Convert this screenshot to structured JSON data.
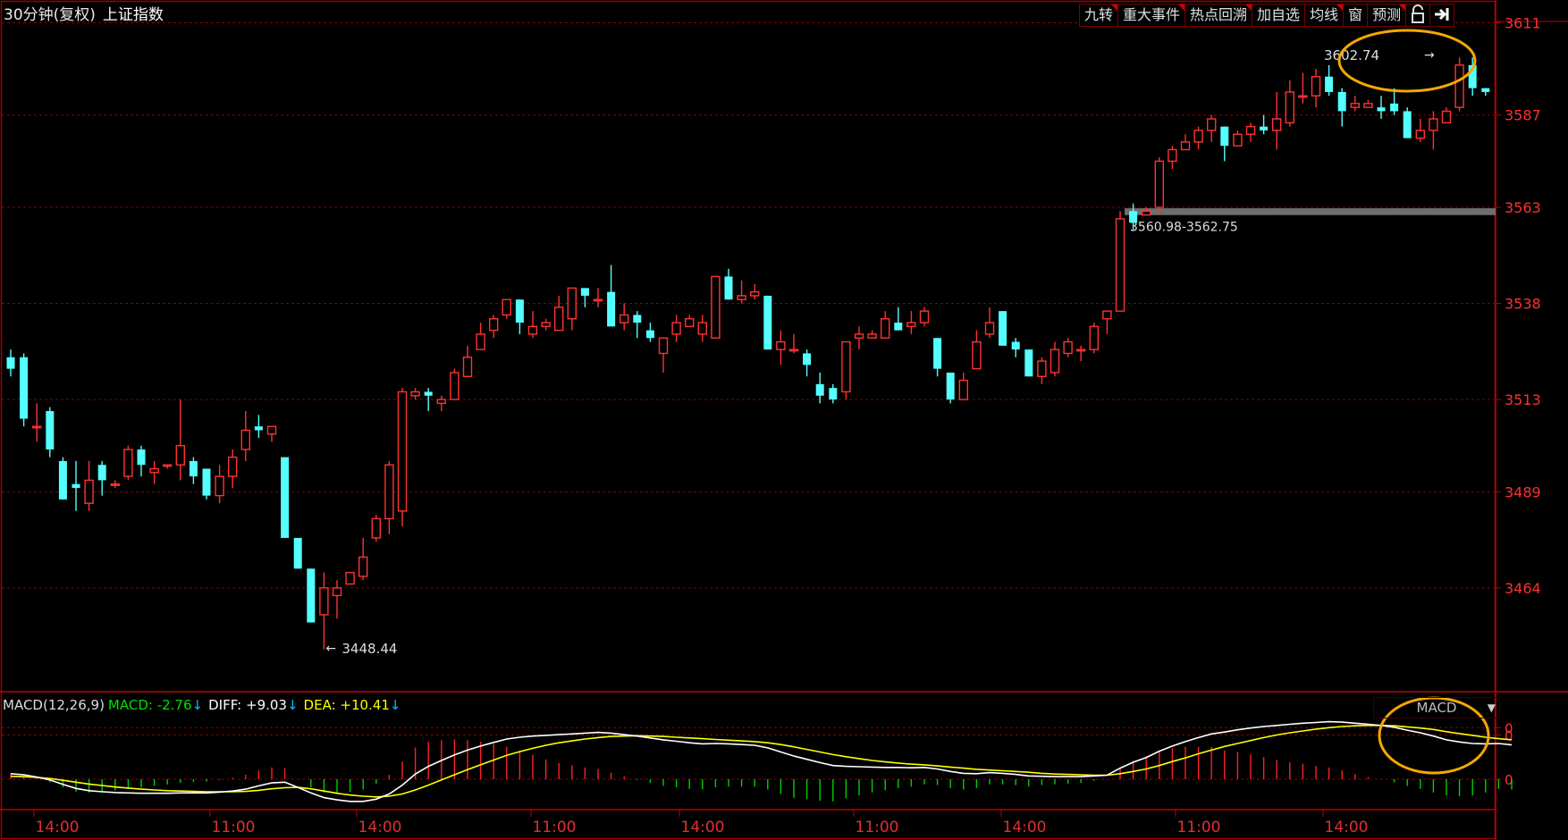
{
  "header": {
    "period": "30分钟(复权)",
    "index_name": "上证指数"
  },
  "toolbar": [
    "九转",
    "重大事件",
    "热点回溯",
    "加自选",
    "均线",
    "窗",
    "预测"
  ],
  "toolbar_icons": [
    "lock-icon",
    "exit-icon"
  ],
  "price_axis": {
    "ticks": [
      "3611",
      "3587",
      "3563",
      "3538",
      "3513",
      "3489",
      "3464"
    ]
  },
  "time_axis": {
    "ticks": [
      "14:00",
      "11:00",
      "14:00",
      "11:00",
      "14:00",
      "11:00",
      "14:00",
      "11:00",
      "14:00"
    ]
  },
  "annotations": {
    "high": "3602.74",
    "low": "3448.44",
    "gap": "3560.98-3562.75"
  },
  "macd": {
    "title": "MACD(12,26,9)",
    "macd_label": "MACD: -2.76",
    "diff_label": "DIFF: +9.03",
    "dea_label": "DEA: +10.41",
    "selector": "MACD",
    "axis_ticks": [
      "0",
      "0",
      "0"
    ]
  },
  "colors": {
    "up": "#ff3232",
    "down": "#54ffff",
    "grid": "#8a0000",
    "axis": "#c00000",
    "diff": "#ffffff",
    "dea": "#ffff00",
    "highlight": "#f5a800"
  },
  "chart_data": {
    "type": "candlestick",
    "ylim": [
      3437,
      3616
    ],
    "candles": [
      [
        3524,
        3521,
        3526,
        3519
      ],
      [
        3524,
        3508,
        3525,
        3506
      ],
      [
        3506,
        3506,
        3512,
        3502
      ],
      [
        3510,
        3500,
        3511,
        3498
      ],
      [
        3497,
        3487,
        3498,
        3487
      ],
      [
        3491,
        3490,
        3497,
        3484
      ],
      [
        3486,
        3492,
        3497,
        3484
      ],
      [
        3496,
        3492,
        3497,
        3488
      ],
      [
        3491,
        3491,
        3492,
        3490
      ],
      [
        3493,
        3500,
        3501,
        3492
      ],
      [
        3500,
        3496,
        3501,
        3493
      ],
      [
        3494,
        3495,
        3497,
        3491
      ],
      [
        3496,
        3496,
        3496,
        3495
      ],
      [
        3496,
        3501,
        3513,
        3492
      ],
      [
        3497,
        3493,
        3498,
        3491
      ],
      [
        3495,
        3488,
        3495,
        3487
      ],
      [
        3488,
        3493,
        3496,
        3486
      ],
      [
        3493,
        3498,
        3500,
        3490
      ],
      [
        3500,
        3505,
        3510,
        3497
      ],
      [
        3506,
        3505,
        3509,
        3503
      ],
      [
        3504,
        3506,
        3506,
        3502
      ],
      [
        3498,
        3477,
        3498,
        3477
      ],
      [
        3477,
        3469,
        3477,
        3469
      ],
      [
        3469,
        3455,
        3469,
        3455
      ],
      [
        3457,
        3464,
        3468,
        3448
      ],
      [
        3462,
        3464,
        3466,
        3456
      ],
      [
        3465,
        3468,
        3468,
        3465
      ],
      [
        3467,
        3472,
        3477,
        3466
      ],
      [
        3477,
        3482,
        3483,
        3476
      ],
      [
        3482,
        3496,
        3497,
        3478
      ],
      [
        3484,
        3515,
        3516,
        3480
      ],
      [
        3514,
        3515,
        3516,
        3513
      ],
      [
        3515,
        3514,
        3516,
        3510
      ],
      [
        3512,
        3513,
        3514,
        3510
      ],
      [
        3513,
        3520,
        3521,
        3513
      ],
      [
        3519,
        3524,
        3527,
        3519
      ],
      [
        3526,
        3530,
        3533,
        3526
      ],
      [
        3531,
        3534,
        3535,
        3529
      ],
      [
        3535,
        3539,
        3539,
        3534
      ],
      [
        3539,
        3533,
        3539,
        3530
      ],
      [
        3530,
        3532,
        3536,
        3529
      ],
      [
        3532,
        3533,
        3534,
        3531
      ],
      [
        3531,
        3537,
        3540,
        3531
      ],
      [
        3534,
        3542,
        3542,
        3531
      ],
      [
        3542,
        3540,
        3541,
        3537
      ],
      [
        3539,
        3539,
        3542,
        3537
      ],
      [
        3541,
        3532,
        3548,
        3532
      ],
      [
        3533,
        3535,
        3538,
        3531
      ],
      [
        3535,
        3533,
        3536,
        3529
      ],
      [
        3531,
        3529,
        3533,
        3528
      ],
      [
        3525,
        3529,
        3529,
        3520
      ],
      [
        3530,
        3533,
        3535,
        3528
      ],
      [
        3532,
        3534,
        3535,
        3532
      ],
      [
        3530,
        3533,
        3535,
        3528
      ],
      [
        3529,
        3545,
        3545,
        3529
      ],
      [
        3545,
        3539,
        3547,
        3539
      ],
      [
        3539,
        3540,
        3544,
        3538
      ],
      [
        3540,
        3541,
        3543,
        3539
      ],
      [
        3540,
        3526,
        3540,
        3526
      ],
      [
        3526,
        3528,
        3531,
        3522
      ],
      [
        3526,
        3526,
        3530,
        3525
      ],
      [
        3525,
        3522,
        3526,
        3519
      ],
      [
        3517,
        3514,
        3520,
        3512
      ],
      [
        3516,
        3513,
        3517,
        3512
      ],
      [
        3515,
        3528,
        3528,
        3513
      ],
      [
        3529,
        3530,
        3532,
        3526
      ],
      [
        3529,
        3530,
        3531,
        3529
      ],
      [
        3529,
        3534,
        3536,
        3529
      ],
      [
        3533,
        3531,
        3537,
        3531
      ],
      [
        3532,
        3533,
        3536,
        3530
      ],
      [
        3533,
        3536,
        3537,
        3532
      ],
      [
        3529,
        3521,
        3529,
        3519
      ],
      [
        3520,
        3513,
        3520,
        3512
      ],
      [
        3513,
        3518,
        3520,
        3515
      ],
      [
        3521,
        3528,
        3531,
        3521
      ],
      [
        3530,
        3533,
        3537,
        3529
      ],
      [
        3536,
        3527,
        3536,
        3527
      ],
      [
        3528,
        3526,
        3529,
        3524
      ],
      [
        3526,
        3519,
        3526,
        3519
      ],
      [
        3519,
        3523,
        3524,
        3517
      ],
      [
        3520,
        3526,
        3528,
        3519
      ],
      [
        3525,
        3528,
        3529,
        3524
      ],
      [
        3526,
        3526,
        3527,
        3523
      ],
      [
        3526,
        3532,
        3533,
        3525
      ],
      [
        3534,
        3536,
        3536,
        3530
      ],
      [
        3536,
        3560,
        3562,
        3536
      ],
      [
        3562,
        3559,
        3564,
        3557
      ],
      [
        3561,
        3562,
        3563,
        3561
      ],
      [
        3563,
        3575,
        3576,
        3561
      ],
      [
        3575,
        3578,
        3579,
        3573
      ],
      [
        3578,
        3580,
        3582,
        3578
      ],
      [
        3580,
        3583,
        3584,
        3578
      ],
      [
        3583,
        3586,
        3587,
        3580
      ],
      [
        3584,
        3579,
        3584,
        3575
      ],
      [
        3579,
        3582,
        3583,
        3579
      ],
      [
        3582,
        3584,
        3585,
        3580
      ],
      [
        3584,
        3583,
        3587,
        3582
      ],
      [
        3583,
        3586,
        3593,
        3578
      ],
      [
        3585,
        3593,
        3596,
        3584
      ],
      [
        3592,
        3592,
        3598,
        3590
      ],
      [
        3592,
        3597,
        3599,
        3589
      ],
      [
        3597,
        3593,
        3600,
        3592
      ],
      [
        3593,
        3588,
        3594,
        3584
      ],
      [
        3589,
        3590,
        3592,
        3588
      ],
      [
        3589,
        3590,
        3591,
        3589
      ],
      [
        3589,
        3588,
        3592,
        3586
      ],
      [
        3590,
        3588,
        3594,
        3587
      ],
      [
        3588,
        3581,
        3589,
        3581
      ],
      [
        3581,
        3583,
        3586,
        3580
      ],
      [
        3583,
        3586,
        3588,
        3578
      ],
      [
        3585,
        3588,
        3589,
        3586
      ],
      [
        3589,
        3600,
        3602,
        3588
      ],
      [
        3600,
        3594,
        3602,
        3592
      ],
      [
        3594,
        3593,
        3594,
        3592
      ]
    ],
    "macd": {
      "ylim": [
        -8,
        16
      ],
      "diff": [
        1.5,
        1.2,
        0.6,
        -0.2,
        -1.4,
        -2.5,
        -3.1,
        -3.4,
        -3.6,
        -3.7,
        -3.8,
        -3.8,
        -3.8,
        -3.7,
        -3.7,
        -3.7,
        -3.5,
        -3.2,
        -2.7,
        -1.8,
        -1.0,
        -0.8,
        -2.2,
        -3.7,
        -5.0,
        -5.6,
        -6.0,
        -6.0,
        -5.4,
        -4.0,
        -1.6,
        1.4,
        3.5,
        5.1,
        6.6,
        7.9,
        9.0,
        10.0,
        10.9,
        11.4,
        11.7,
        11.9,
        12.1,
        12.3,
        12.5,
        12.7,
        12.5,
        12.1,
        11.7,
        11.2,
        10.7,
        10.3,
        9.9,
        9.6,
        9.7,
        9.6,
        9.4,
        9.2,
        8.5,
        7.4,
        6.3,
        5.4,
        4.5,
        3.7,
        3.5,
        3.4,
        3.3,
        3.2,
        3.2,
        3.1,
        3.2,
        2.8,
        2.1,
        1.6,
        1.5,
        1.8,
        1.6,
        1.3,
        0.9,
        0.8,
        0.7,
        0.7,
        0.7,
        0.9,
        1.1,
        3.0,
        4.6,
        5.9,
        7.6,
        9.0,
        10.2,
        11.3,
        12.3,
        12.8,
        13.4,
        13.9,
        14.3,
        14.6,
        14.9,
        15.2,
        15.4,
        15.6,
        15.5,
        15.2,
        14.9,
        14.6,
        14.1,
        13.3,
        12.6,
        11.7,
        10.7,
        10.1,
        9.7,
        9.6,
        9.7,
        9.3
      ],
      "dea": [
        0.8,
        0.7,
        0.5,
        0.2,
        -0.3,
        -0.8,
        -1.3,
        -1.7,
        -2.1,
        -2.4,
        -2.7,
        -2.9,
        -3.1,
        -3.2,
        -3.3,
        -3.4,
        -3.4,
        -3.4,
        -3.3,
        -3.0,
        -2.6,
        -2.3,
        -2.2,
        -2.6,
        -3.2,
        -3.8,
        -4.3,
        -4.6,
        -4.8,
        -4.6,
        -4.0,
        -2.9,
        -1.6,
        -0.2,
        1.2,
        2.6,
        3.9,
        5.2,
        6.5,
        7.5,
        8.4,
        9.2,
        9.9,
        10.4,
        10.9,
        11.3,
        11.6,
        11.7,
        11.8,
        11.7,
        11.6,
        11.4,
        11.2,
        11.0,
        10.8,
        10.6,
        10.4,
        10.2,
        9.9,
        9.4,
        8.8,
        8.1,
        7.4,
        6.7,
        6.1,
        5.6,
        5.1,
        4.7,
        4.4,
        4.1,
        3.9,
        3.6,
        3.3,
        3.0,
        2.7,
        2.5,
        2.3,
        2.1,
        1.9,
        1.6,
        1.4,
        1.3,
        1.2,
        1.1,
        1.1,
        1.5,
        2.1,
        2.8,
        3.7,
        4.8,
        5.8,
        6.9,
        7.9,
        8.9,
        9.7,
        10.5,
        11.3,
        12.0,
        12.6,
        13.1,
        13.6,
        14.0,
        14.3,
        14.5,
        14.6,
        14.6,
        14.5,
        14.2,
        13.9,
        13.5,
        12.9,
        12.4,
        11.9,
        11.4,
        11.0,
        10.7
      ]
    }
  }
}
